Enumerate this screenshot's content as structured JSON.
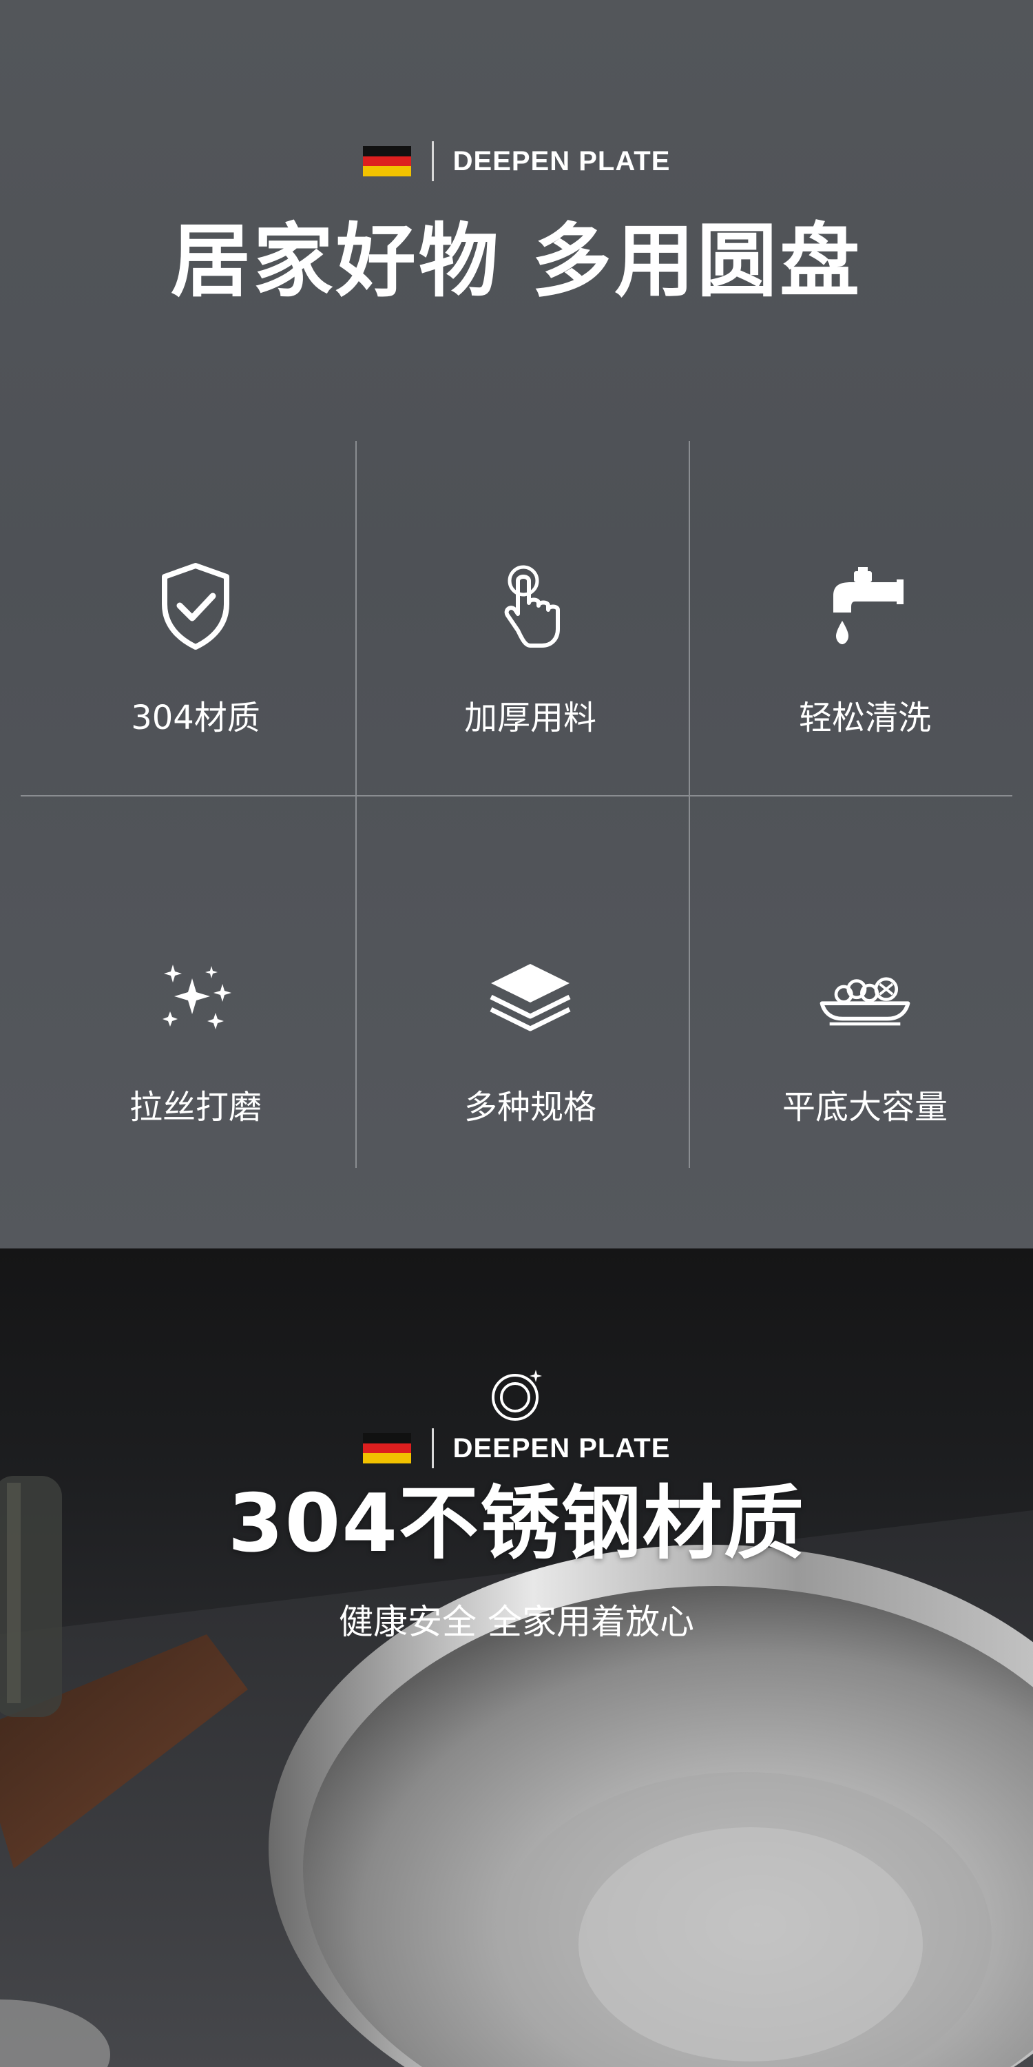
{
  "section1": {
    "brand_text": "DEEPEN PLATE",
    "title": "居家好物 多用圆盘",
    "features": [
      {
        "label": "304材质",
        "icon": "shield-check-icon"
      },
      {
        "label": "加厚用料",
        "icon": "finger-touch-icon"
      },
      {
        "label": "轻松清洗",
        "icon": "water-tap-icon"
      },
      {
        "label": "拉丝打磨",
        "icon": "sparkles-icon"
      },
      {
        "label": "多种规格",
        "icon": "layers-icon"
      },
      {
        "label": "平底大容量",
        "icon": "food-plate-icon"
      }
    ]
  },
  "section2": {
    "brand_text": "DEEPEN PLATE",
    "title": "304不锈钢材质",
    "subtitle": "健康安全 全家用着放心",
    "badge_icon": "shiny-plate-icon"
  },
  "colors": {
    "flag_black": "#111111",
    "flag_red": "#dd1f1f",
    "flag_gold": "#f2c200",
    "section1_bg": "#4f5257",
    "section2_bg": "#1c1d1f"
  }
}
